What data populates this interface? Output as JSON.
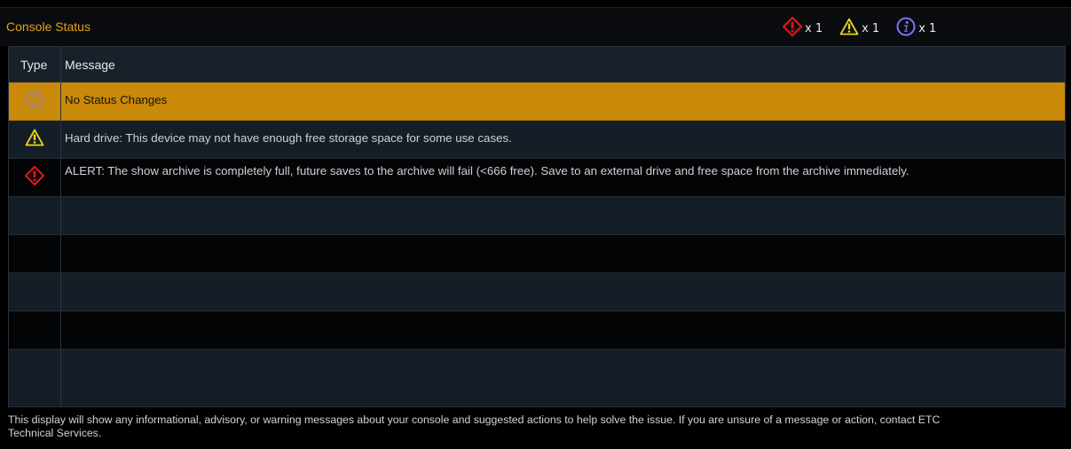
{
  "header": {
    "title": "Console Status",
    "counts": [
      {
        "icon": "alert-icon",
        "label": "x 1",
        "color": "#e0141e"
      },
      {
        "icon": "warning-icon",
        "label": "x 1",
        "color": "#e8d61a"
      },
      {
        "icon": "info-icon",
        "label": "x 1",
        "color": "#7b76ff"
      }
    ]
  },
  "table": {
    "columns": [
      "Type",
      "Message"
    ],
    "rows": [
      {
        "type": "info-icon",
        "message": "No Status Changes",
        "selected": true
      },
      {
        "type": "warning-icon",
        "message": "Hard drive: This device may not have enough free storage space for some use cases."
      },
      {
        "type": "alert-icon",
        "message": "ALERT: The show archive is completely full, future saves to the archive will fail (<666 free). Save to an external drive and free space from the archive immediately."
      },
      {
        "type": "",
        "message": ""
      },
      {
        "type": "",
        "message": ""
      },
      {
        "type": "",
        "message": ""
      },
      {
        "type": "",
        "message": ""
      },
      {
        "type": "",
        "message": ""
      }
    ]
  },
  "footer": {
    "text": "This display will show any informational, advisory, or warning messages about your console and suggested actions to help solve the issue. If you are unsure of a message or action, contact ETC Technical Services."
  },
  "colors": {
    "title": "#e0a21c",
    "selected_row": "#c98909",
    "alert": "#e0141e",
    "warning": "#e8d61a",
    "info": "#7b76ff"
  }
}
